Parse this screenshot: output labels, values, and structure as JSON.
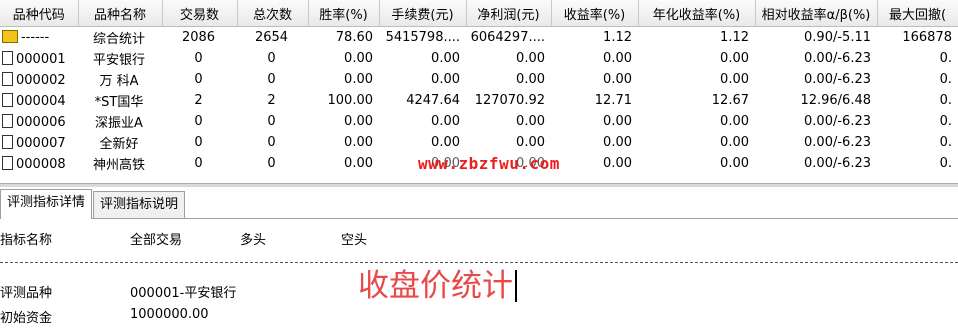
{
  "table": {
    "columns": [
      "品种代码",
      "品种名称",
      "交易数",
      "总次数",
      "胜率(%)",
      "手续费(元)",
      "净利润(元)",
      "收益率(%)",
      "年化收益率(%)",
      "相对收益率α/β(%)",
      "最大回撤("
    ],
    "rows": [
      {
        "icon": "summary",
        "code": "------",
        "name": "综合统计",
        "trades": "2086",
        "total": "2654",
        "win": "78.60",
        "fee": "5415798....",
        "profit": "6064297....",
        "ret": "1.12",
        "annual": "1.12",
        "alpha": "0.90/-5.11",
        "drawdown": "166878"
      },
      {
        "icon": "doc",
        "code": "000001",
        "name": "平安银行",
        "trades": "0",
        "total": "0",
        "win": "0.00",
        "fee": "0.00",
        "profit": "0.00",
        "ret": "0.00",
        "annual": "0.00",
        "alpha": "0.00/-6.23",
        "drawdown": "0."
      },
      {
        "icon": "doc",
        "code": "000002",
        "name": "万 科A",
        "trades": "0",
        "total": "0",
        "win": "0.00",
        "fee": "0.00",
        "profit": "0.00",
        "ret": "0.00",
        "annual": "0.00",
        "alpha": "0.00/-6.23",
        "drawdown": "0."
      },
      {
        "icon": "doc",
        "code": "000004",
        "name": "*ST国华",
        "trades": "2",
        "total": "2",
        "win": "100.00",
        "fee": "4247.64",
        "profit": "127070.92",
        "ret": "12.71",
        "annual": "12.67",
        "alpha": "12.96/6.48",
        "drawdown": "0."
      },
      {
        "icon": "doc",
        "code": "000006",
        "name": "深振业A",
        "trades": "0",
        "total": "0",
        "win": "0.00",
        "fee": "0.00",
        "profit": "0.00",
        "ret": "0.00",
        "annual": "0.00",
        "alpha": "0.00/-6.23",
        "drawdown": "0."
      },
      {
        "icon": "doc",
        "code": "000007",
        "name": "全新好",
        "trades": "0",
        "total": "0",
        "win": "0.00",
        "fee": "0.00",
        "profit": "0.00",
        "ret": "0.00",
        "annual": "0.00",
        "alpha": "0.00/-6.23",
        "drawdown": "0."
      },
      {
        "icon": "doc",
        "code": "000008",
        "name": "神州高铁",
        "trades": "0",
        "total": "0",
        "win": "0.00",
        "fee": "0.00",
        "profit": "0.00",
        "ret": "0.00",
        "annual": "0.00",
        "alpha": "0.00/-6.23",
        "drawdown": "0."
      }
    ]
  },
  "watermark": "www.zbzfwu.com",
  "tabs": [
    "评测指标详情",
    "评测指标说明"
  ],
  "detail": {
    "headers": [
      "指标名称",
      "全部交易",
      "多头",
      "空头"
    ],
    "rows": [
      {
        "label": "评测品种",
        "value": "000001-平安银行"
      },
      {
        "label": "初始资金",
        "value": "1000000.00"
      }
    ]
  },
  "annotation": "收盘价统计",
  "icons": {
    "summary": "summary-sheet-icon",
    "doc": "document-icon"
  }
}
